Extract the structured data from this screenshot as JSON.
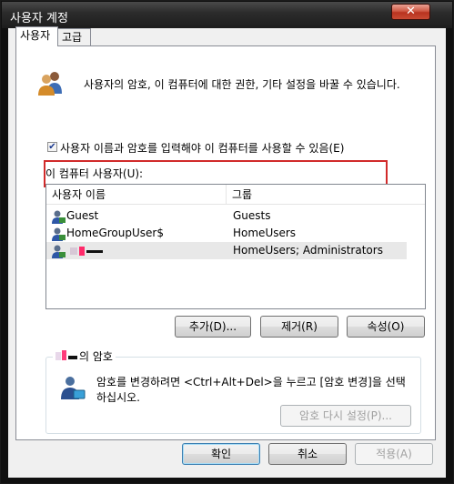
{
  "window": {
    "title": "사용자 계정",
    "close_glyph": "✕"
  },
  "tabs": [
    {
      "label": "사용자"
    },
    {
      "label": "고급"
    }
  ],
  "intro_text": "사용자의 암호, 이 컴퓨터에 대한  권한, 기타 설정을 바꿀 수 있습니다.",
  "require_login": {
    "checked": true,
    "check_glyph": "✔",
    "label": "사용자 이름과 암호를 입력해야 이 컴퓨터를 사용할 수 있음(E)"
  },
  "users_list": {
    "label": "이 컴퓨터 사용자(U):",
    "columns": [
      "사용자 이름",
      "그룹"
    ],
    "rows": [
      {
        "name": "Guest",
        "group": "Guests"
      },
      {
        "name": "HomeGroupUser$",
        "group": "HomeUsers"
      },
      {
        "name": "",
        "group": "HomeUsers; Administrators",
        "selected": true
      }
    ]
  },
  "buttons": {
    "add": "추가(D)...",
    "remove": "제거(R)",
    "properties": "속성(O)"
  },
  "password_group": {
    "title_suffix": "의 암호",
    "text": "암호를 변경하려면 <Ctrl+Alt+Del>을 누르고 [암호 변경]을 선택하십시오.",
    "reset_button": "암호 다시 설정(P)..."
  },
  "footer": {
    "ok": "확인",
    "cancel": "취소",
    "apply": "적용(A)"
  },
  "colors": {
    "highlight_border": "#d12a2a",
    "selected_row": "#e8e8e8",
    "title_bar": "#2c2c2c"
  }
}
